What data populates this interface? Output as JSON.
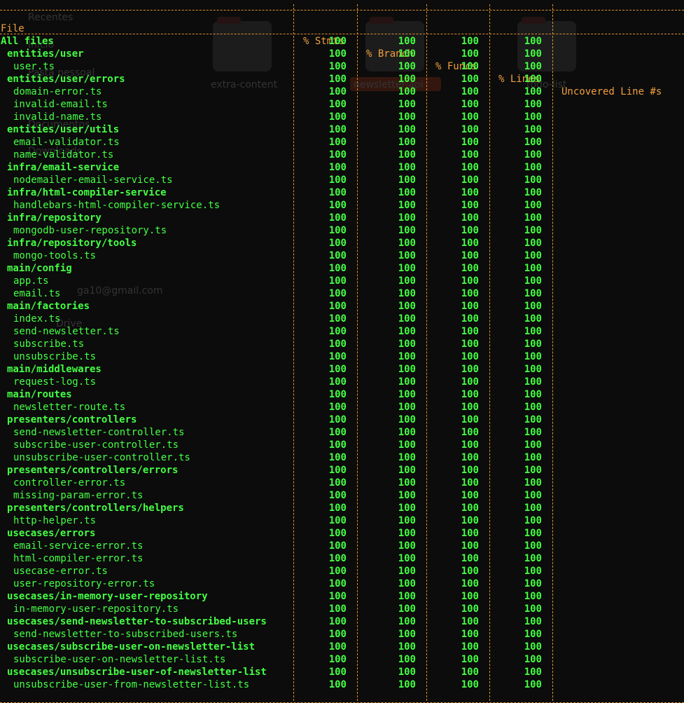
{
  "background": {
    "ghost_texts": [
      "Recentes",
      "Início",
      "Pasta pessoal",
      "Documentos",
      "Downloads",
      "ga10@gmail.com",
      "Drive"
    ],
    "folders": [
      "extra-content",
      "newsletter-api",
      "todo-list"
    ]
  },
  "colors": {
    "background": "#0c0c0c",
    "header": "#f0a040",
    "separator": "#e09030",
    "covered": "#44ff44"
  },
  "table": {
    "headers": {
      "file": "File",
      "stmts": "% Stmts",
      "branch": "% Branch",
      "funcs": "% Funcs",
      "lines": "% Lines",
      "uncovered": "Uncovered Line #s"
    },
    "rows": [
      {
        "file": "All files",
        "kind": "all",
        "stmts": "100",
        "branch": "100",
        "funcs": "100",
        "lines": "100",
        "uncovered": ""
      },
      {
        "file": "entities/user",
        "kind": "dir",
        "stmts": "100",
        "branch": "100",
        "funcs": "100",
        "lines": "100",
        "uncovered": ""
      },
      {
        "file": "user.ts",
        "kind": "leaf",
        "stmts": "100",
        "branch": "100",
        "funcs": "100",
        "lines": "100",
        "uncovered": ""
      },
      {
        "file": "entities/user/errors",
        "kind": "dir",
        "stmts": "100",
        "branch": "100",
        "funcs": "100",
        "lines": "100",
        "uncovered": ""
      },
      {
        "file": "domain-error.ts",
        "kind": "leaf",
        "stmts": "100",
        "branch": "100",
        "funcs": "100",
        "lines": "100",
        "uncovered": ""
      },
      {
        "file": "invalid-email.ts",
        "kind": "leaf",
        "stmts": "100",
        "branch": "100",
        "funcs": "100",
        "lines": "100",
        "uncovered": ""
      },
      {
        "file": "invalid-name.ts",
        "kind": "leaf",
        "stmts": "100",
        "branch": "100",
        "funcs": "100",
        "lines": "100",
        "uncovered": ""
      },
      {
        "file": "entities/user/utils",
        "kind": "dir",
        "stmts": "100",
        "branch": "100",
        "funcs": "100",
        "lines": "100",
        "uncovered": ""
      },
      {
        "file": "email-validator.ts",
        "kind": "leaf",
        "stmts": "100",
        "branch": "100",
        "funcs": "100",
        "lines": "100",
        "uncovered": ""
      },
      {
        "file": "name-validator.ts",
        "kind": "leaf",
        "stmts": "100",
        "branch": "100",
        "funcs": "100",
        "lines": "100",
        "uncovered": ""
      },
      {
        "file": "infra/email-service",
        "kind": "dir",
        "stmts": "100",
        "branch": "100",
        "funcs": "100",
        "lines": "100",
        "uncovered": ""
      },
      {
        "file": "nodemailer-email-service.ts",
        "kind": "leaf",
        "stmts": "100",
        "branch": "100",
        "funcs": "100",
        "lines": "100",
        "uncovered": ""
      },
      {
        "file": "infra/html-compiler-service",
        "kind": "dir",
        "stmts": "100",
        "branch": "100",
        "funcs": "100",
        "lines": "100",
        "uncovered": ""
      },
      {
        "file": "handlebars-html-compiler-service.ts",
        "kind": "leaf",
        "stmts": "100",
        "branch": "100",
        "funcs": "100",
        "lines": "100",
        "uncovered": ""
      },
      {
        "file": "infra/repository",
        "kind": "dir",
        "stmts": "100",
        "branch": "100",
        "funcs": "100",
        "lines": "100",
        "uncovered": ""
      },
      {
        "file": "mongodb-user-repository.ts",
        "kind": "leaf",
        "stmts": "100",
        "branch": "100",
        "funcs": "100",
        "lines": "100",
        "uncovered": ""
      },
      {
        "file": "infra/repository/tools",
        "kind": "dir",
        "stmts": "100",
        "branch": "100",
        "funcs": "100",
        "lines": "100",
        "uncovered": ""
      },
      {
        "file": "mongo-tools.ts",
        "kind": "leaf",
        "stmts": "100",
        "branch": "100",
        "funcs": "100",
        "lines": "100",
        "uncovered": ""
      },
      {
        "file": "main/config",
        "kind": "dir",
        "stmts": "100",
        "branch": "100",
        "funcs": "100",
        "lines": "100",
        "uncovered": ""
      },
      {
        "file": "app.ts",
        "kind": "leaf",
        "stmts": "100",
        "branch": "100",
        "funcs": "100",
        "lines": "100",
        "uncovered": ""
      },
      {
        "file": "email.ts",
        "kind": "leaf",
        "stmts": "100",
        "branch": "100",
        "funcs": "100",
        "lines": "100",
        "uncovered": ""
      },
      {
        "file": "main/factories",
        "kind": "dir",
        "stmts": "100",
        "branch": "100",
        "funcs": "100",
        "lines": "100",
        "uncovered": ""
      },
      {
        "file": "index.ts",
        "kind": "leaf",
        "stmts": "100",
        "branch": "100",
        "funcs": "100",
        "lines": "100",
        "uncovered": ""
      },
      {
        "file": "send-newsletter.ts",
        "kind": "leaf",
        "stmts": "100",
        "branch": "100",
        "funcs": "100",
        "lines": "100",
        "uncovered": ""
      },
      {
        "file": "subscribe.ts",
        "kind": "leaf",
        "stmts": "100",
        "branch": "100",
        "funcs": "100",
        "lines": "100",
        "uncovered": ""
      },
      {
        "file": "unsubscribe.ts",
        "kind": "leaf",
        "stmts": "100",
        "branch": "100",
        "funcs": "100",
        "lines": "100",
        "uncovered": ""
      },
      {
        "file": "main/middlewares",
        "kind": "dir",
        "stmts": "100",
        "branch": "100",
        "funcs": "100",
        "lines": "100",
        "uncovered": ""
      },
      {
        "file": "request-log.ts",
        "kind": "leaf",
        "stmts": "100",
        "branch": "100",
        "funcs": "100",
        "lines": "100",
        "uncovered": ""
      },
      {
        "file": "main/routes",
        "kind": "dir",
        "stmts": "100",
        "branch": "100",
        "funcs": "100",
        "lines": "100",
        "uncovered": ""
      },
      {
        "file": "newsletter-route.ts",
        "kind": "leaf",
        "stmts": "100",
        "branch": "100",
        "funcs": "100",
        "lines": "100",
        "uncovered": ""
      },
      {
        "file": "presenters/controllers",
        "kind": "dir",
        "stmts": "100",
        "branch": "100",
        "funcs": "100",
        "lines": "100",
        "uncovered": ""
      },
      {
        "file": "send-newsletter-controller.ts",
        "kind": "leaf",
        "stmts": "100",
        "branch": "100",
        "funcs": "100",
        "lines": "100",
        "uncovered": ""
      },
      {
        "file": "subscribe-user-controller.ts",
        "kind": "leaf",
        "stmts": "100",
        "branch": "100",
        "funcs": "100",
        "lines": "100",
        "uncovered": ""
      },
      {
        "file": "unsubscribe-user-controller.ts",
        "kind": "leaf",
        "stmts": "100",
        "branch": "100",
        "funcs": "100",
        "lines": "100",
        "uncovered": ""
      },
      {
        "file": "presenters/controllers/errors",
        "kind": "dir",
        "stmts": "100",
        "branch": "100",
        "funcs": "100",
        "lines": "100",
        "uncovered": ""
      },
      {
        "file": "controller-error.ts",
        "kind": "leaf",
        "stmts": "100",
        "branch": "100",
        "funcs": "100",
        "lines": "100",
        "uncovered": ""
      },
      {
        "file": "missing-param-error.ts",
        "kind": "leaf",
        "stmts": "100",
        "branch": "100",
        "funcs": "100",
        "lines": "100",
        "uncovered": ""
      },
      {
        "file": "presenters/controllers/helpers",
        "kind": "dir",
        "stmts": "100",
        "branch": "100",
        "funcs": "100",
        "lines": "100",
        "uncovered": ""
      },
      {
        "file": "http-helper.ts",
        "kind": "leaf",
        "stmts": "100",
        "branch": "100",
        "funcs": "100",
        "lines": "100",
        "uncovered": ""
      },
      {
        "file": "usecases/errors",
        "kind": "dir",
        "stmts": "100",
        "branch": "100",
        "funcs": "100",
        "lines": "100",
        "uncovered": ""
      },
      {
        "file": "email-service-error.ts",
        "kind": "leaf",
        "stmts": "100",
        "branch": "100",
        "funcs": "100",
        "lines": "100",
        "uncovered": ""
      },
      {
        "file": "html-compiler-error.ts",
        "kind": "leaf",
        "stmts": "100",
        "branch": "100",
        "funcs": "100",
        "lines": "100",
        "uncovered": ""
      },
      {
        "file": "usecase-error.ts",
        "kind": "leaf",
        "stmts": "100",
        "branch": "100",
        "funcs": "100",
        "lines": "100",
        "uncovered": ""
      },
      {
        "file": "user-repository-error.ts",
        "kind": "leaf",
        "stmts": "100",
        "branch": "100",
        "funcs": "100",
        "lines": "100",
        "uncovered": ""
      },
      {
        "file": "usecases/in-memory-user-repository",
        "kind": "dir",
        "stmts": "100",
        "branch": "100",
        "funcs": "100",
        "lines": "100",
        "uncovered": ""
      },
      {
        "file": "in-memory-user-repository.ts",
        "kind": "leaf",
        "stmts": "100",
        "branch": "100",
        "funcs": "100",
        "lines": "100",
        "uncovered": ""
      },
      {
        "file": "usecases/send-newsletter-to-subscribed-users",
        "kind": "dir",
        "stmts": "100",
        "branch": "100",
        "funcs": "100",
        "lines": "100",
        "uncovered": ""
      },
      {
        "file": "send-newsletter-to-subscribed-users.ts",
        "kind": "leaf",
        "stmts": "100",
        "branch": "100",
        "funcs": "100",
        "lines": "100",
        "uncovered": ""
      },
      {
        "file": "usecases/subscribe-user-on-newsletter-list",
        "kind": "dir",
        "stmts": "100",
        "branch": "100",
        "funcs": "100",
        "lines": "100",
        "uncovered": ""
      },
      {
        "file": "subscribe-user-on-newsletter-list.ts",
        "kind": "leaf",
        "stmts": "100",
        "branch": "100",
        "funcs": "100",
        "lines": "100",
        "uncovered": ""
      },
      {
        "file": "usecases/unsubscribe-user-of-newsletter-list",
        "kind": "dir",
        "stmts": "100",
        "branch": "100",
        "funcs": "100",
        "lines": "100",
        "uncovered": ""
      },
      {
        "file": "unsubscribe-user-from-newsletter-list.ts",
        "kind": "leaf",
        "stmts": "100",
        "branch": "100",
        "funcs": "100",
        "lines": "100",
        "uncovered": ""
      }
    ]
  }
}
